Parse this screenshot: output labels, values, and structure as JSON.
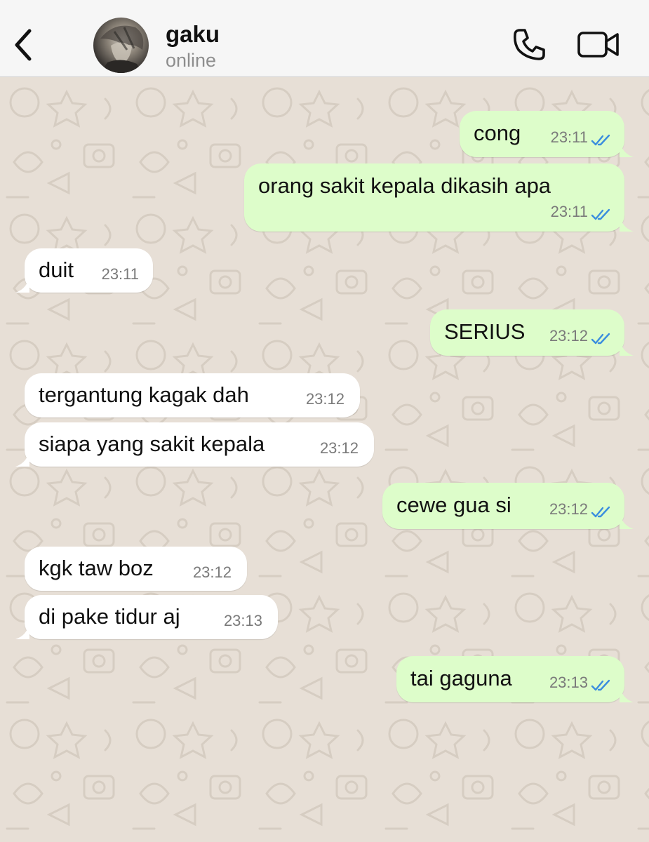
{
  "contact": {
    "name": "gaku",
    "status": "online"
  },
  "colors": {
    "outgoing": "#ddfdca",
    "incoming": "#ffffff",
    "ticks": "#3a8dde",
    "background": "#e7dfd6"
  },
  "icons": {
    "back": "chevron-left-icon",
    "call": "phone-icon",
    "video": "video-camera-icon",
    "read_receipt": "double-check-icon"
  },
  "messages": [
    {
      "direction": "out",
      "text": "cong",
      "time": "23:11",
      "status": "read"
    },
    {
      "direction": "out",
      "text": "orang sakit kepala dikasih apa",
      "time": "23:11",
      "status": "read"
    },
    {
      "direction": "in",
      "text": "duit",
      "time": "23:11"
    },
    {
      "direction": "out",
      "text": "SERIUS",
      "time": "23:12",
      "status": "read"
    },
    {
      "direction": "in",
      "text": "tergantung kagak dah",
      "time": "23:12"
    },
    {
      "direction": "in",
      "text": "siapa yang sakit kepala",
      "time": "23:12"
    },
    {
      "direction": "out",
      "text": "cewe gua si",
      "time": "23:12",
      "status": "read"
    },
    {
      "direction": "in",
      "text": "kgk taw boz",
      "time": "23:12"
    },
    {
      "direction": "in",
      "text": "di pake tidur aj",
      "time": "23:13"
    },
    {
      "direction": "out",
      "text": "tai gaguna",
      "time": "23:13",
      "status": "read"
    }
  ]
}
